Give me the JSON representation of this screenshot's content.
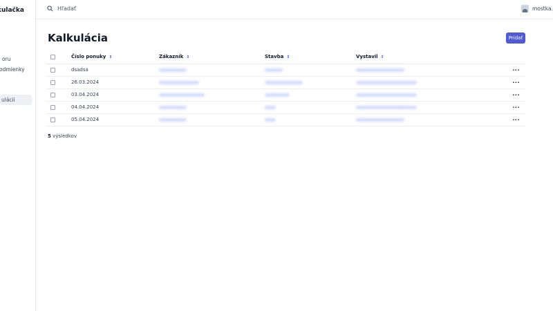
{
  "sidebar": {
    "brand": "kulačka",
    "items": [
      {
        "label": "oru"
      },
      {
        "label": "odmienky"
      },
      {
        "label": "ulácii"
      }
    ]
  },
  "topbar": {
    "search_label": "Hľadať",
    "user_name": "mostka.je"
  },
  "page": {
    "title": "Kalkulácia",
    "add_label": "Pridať",
    "result_count": "5",
    "result_suffix": "výsledkov"
  },
  "table": {
    "columns": [
      "Číslo ponuky",
      "Zákazník",
      "Stavba",
      "Vystavil"
    ],
    "rows": [
      {
        "offer": "dsadsa"
      },
      {
        "offer": "26.03.2024"
      },
      {
        "offer": "03.04.2024"
      },
      {
        "offer": "04.04.2024"
      },
      {
        "offer": "05.04.2024"
      }
    ],
    "actions_label": "···"
  },
  "colors": {
    "accent": "#4f5bd5"
  }
}
